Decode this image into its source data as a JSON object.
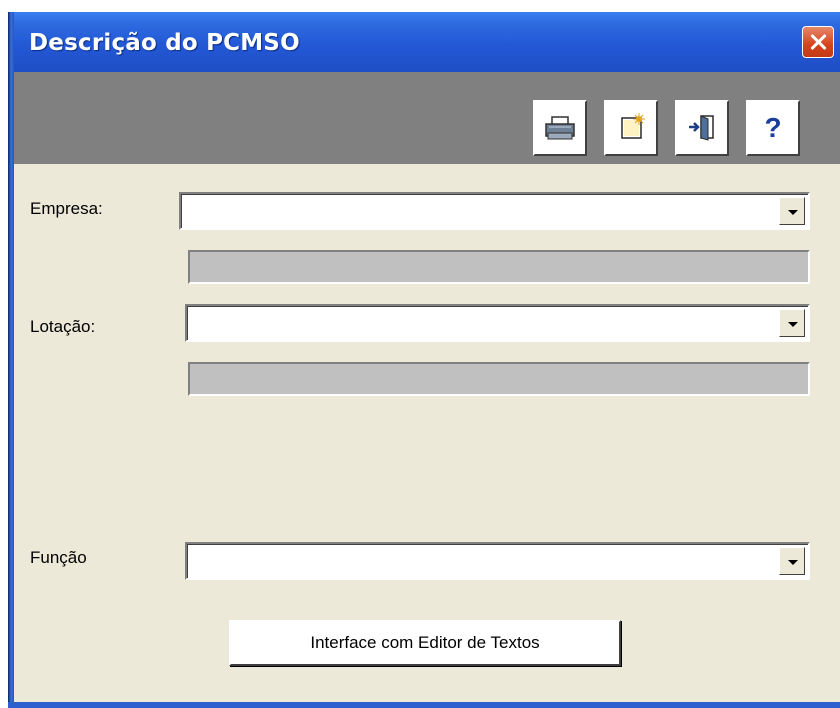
{
  "window": {
    "title": "Descrição do PCMSO"
  },
  "toolbar": {
    "buttons": [
      {
        "icon": "printer-icon"
      },
      {
        "icon": "new-document-icon"
      },
      {
        "icon": "exit-door-icon"
      },
      {
        "icon": "help-icon",
        "glyph": "?"
      }
    ]
  },
  "form": {
    "empresa": {
      "label": "Empresa:",
      "value": "",
      "description": ""
    },
    "lotacao": {
      "label": "Lotação:",
      "value": "",
      "description": ""
    },
    "funcao": {
      "label": "Função",
      "value": ""
    }
  },
  "actions": {
    "editor_button_label": "Interface com Editor de Textos"
  },
  "colors": {
    "titlebar": "#2458d6",
    "toolbar": "#808080",
    "body": "#ece9d8",
    "close": "#d5431b",
    "help_glyph": "#1c3f9c"
  }
}
